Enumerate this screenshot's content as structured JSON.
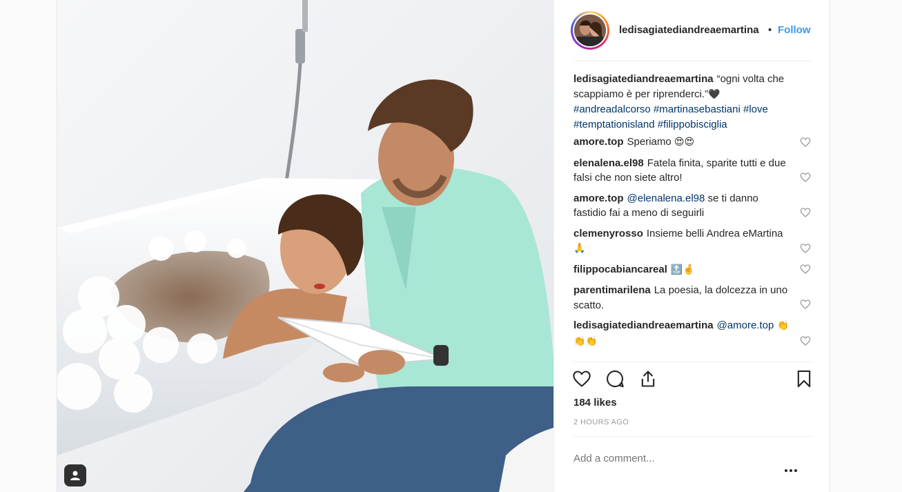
{
  "post": {
    "username": "ledisagiatediandreaemartina",
    "separator": "•",
    "follow_label": "Follow",
    "caption": {
      "username": "ledisagiatediandreaemartina",
      "text": "“ogni volta che scappiamo è per riprenderci.”",
      "emoji": "🖤",
      "hashtags": [
        "#andreadalcorso",
        "#martinasebastiani",
        "#love",
        "#temptationisland",
        "#filippobisciglia"
      ]
    },
    "comments": [
      {
        "user": "amore.top",
        "text": "Speriamo",
        "emoji": "😍😍"
      },
      {
        "user": "elenalena.el98",
        "text": "Fatela finita, sparite tutti e due falsi che non siete altro!",
        "emoji": ""
      },
      {
        "user": "amore.top",
        "mention": "@elenalena.el98",
        "text": "se ti danno fastidio fai a meno di seguirli",
        "emoji": ""
      },
      {
        "user": "clemenyrosso",
        "text": "Insieme belli Andrea eMartina",
        "emoji": "🙏"
      },
      {
        "user": "filippocabiancareal",
        "text": "",
        "emoji": "🔝🤞"
      },
      {
        "user": "parentimarilena",
        "text": "La poesia, la dolcezza in uno scatto.",
        "emoji": ""
      },
      {
        "user": "ledisagiatediandreaemartina",
        "mention": "@amore.top",
        "text": "",
        "emoji": "👏👏👏"
      }
    ],
    "likes": "184 likes",
    "timestamp": "2 HOURS AGO",
    "add_comment_placeholder": "Add a comment...",
    "icons": {
      "like": "heart-icon",
      "comment": "comment-icon",
      "share": "share-icon",
      "save": "bookmark-icon",
      "more": "more-options-icon",
      "tagged": "user-tag-icon"
    },
    "colors": {
      "link": "#3897f0",
      "hashtag": "#003569",
      "text": "#262626",
      "muted": "#999999"
    }
  }
}
